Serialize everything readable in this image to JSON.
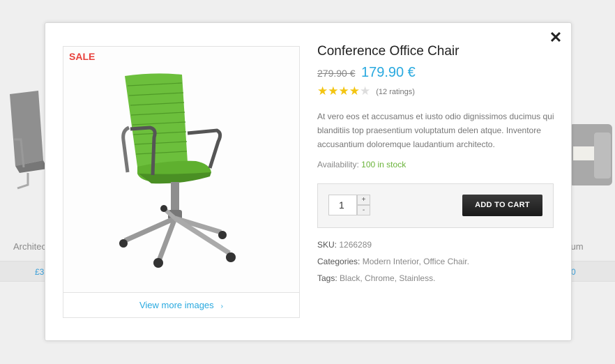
{
  "background": {
    "left_product_name": "Architec",
    "left_product_price": "£3",
    "right_product_name": "tium",
    "right_product_price": "0"
  },
  "modal": {
    "close_icon": "✕",
    "sale_badge": "SALE",
    "view_more_label": "View more images",
    "view_more_chevron": "›",
    "title": "Conference Office Chair",
    "old_price": "279.90 €",
    "new_price": "179.90 €",
    "rating": {
      "value": 4,
      "max": 5,
      "count_text": "(12 ratings)"
    },
    "description": "At vero eos et accusamus et iusto odio dignissimos ducimus qui blanditiis top praesentium voluptatum delen atque. Inventore accusantium doloremque laudantium architecto.",
    "availability_label": "Availability:",
    "availability_value": "100 in stock",
    "quantity": "1",
    "qty_plus": "+",
    "qty_minus": "-",
    "add_to_cart_label": "ADD TO CART",
    "sku_label": "SKU:",
    "sku_value": "1266289",
    "categories_label": "Categories:",
    "categories": [
      "Modern Interior",
      "Office Chair."
    ],
    "tags_label": "Tags:",
    "tags": [
      "Black",
      "Chrome",
      "Stainless."
    ]
  },
  "colors": {
    "accent_blue": "#29a9df",
    "sale_red": "#e8413c",
    "stock_green": "#6ab33a",
    "star_gold": "#f3c512",
    "chair_green": "#6cbf3c"
  }
}
